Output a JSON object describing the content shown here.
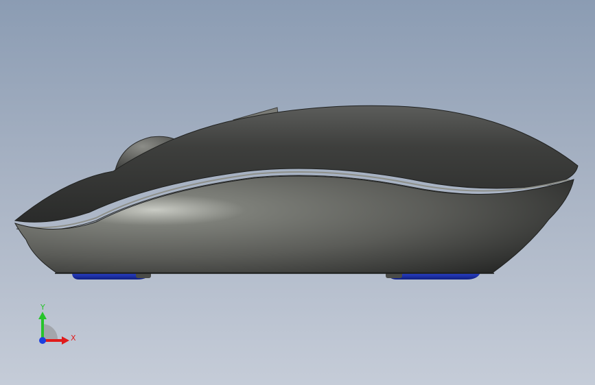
{
  "triad": {
    "y_label": "Y",
    "x_label": "X",
    "colors": {
      "y": "#27c42b",
      "x": "#e01b1b",
      "z": "#1b3fe0"
    }
  },
  "colors": {
    "background_top": "#8b9cb3",
    "background_bottom": "#c5ccd8",
    "body": "#4b4c4a",
    "feet": "#1a2fb8"
  }
}
